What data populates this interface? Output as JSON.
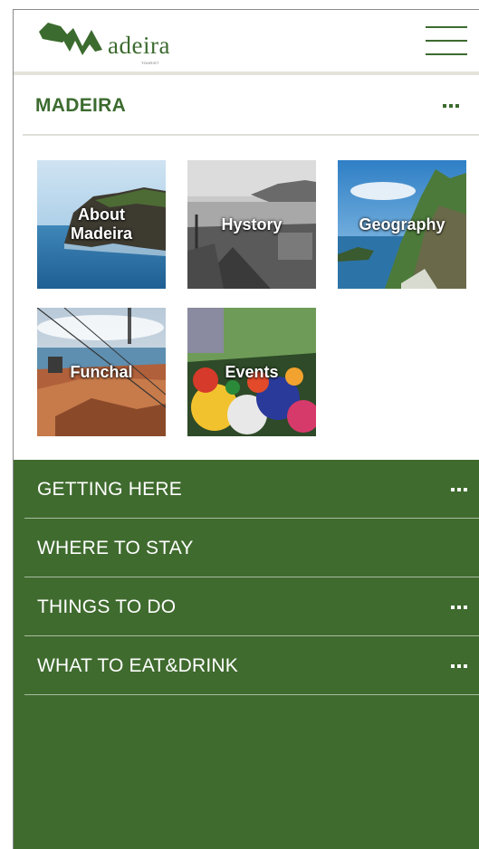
{
  "header": {
    "logo_text": "adeira",
    "logo_subtext": "TOURIST",
    "menu_icon": "hamburger-icon",
    "brand_color": "#3c6b2f"
  },
  "section": {
    "title": "MADEIRA",
    "more_icon": "more-dots-icon"
  },
  "tiles": [
    {
      "label": "About\nMadeira"
    },
    {
      "label": "Hystory"
    },
    {
      "label": "Geography"
    },
    {
      "label": "Funchal"
    },
    {
      "label": "Events"
    }
  ],
  "menu": {
    "background_color": "#3f6b2e",
    "items": [
      {
        "label": "GETTING HERE",
        "has_more": true
      },
      {
        "label": "WHERE TO STAY",
        "has_more": false
      },
      {
        "label": "THINGS TO DO",
        "has_more": true
      },
      {
        "label": "WHAT TO EAT&DRINK",
        "has_more": true
      }
    ]
  }
}
